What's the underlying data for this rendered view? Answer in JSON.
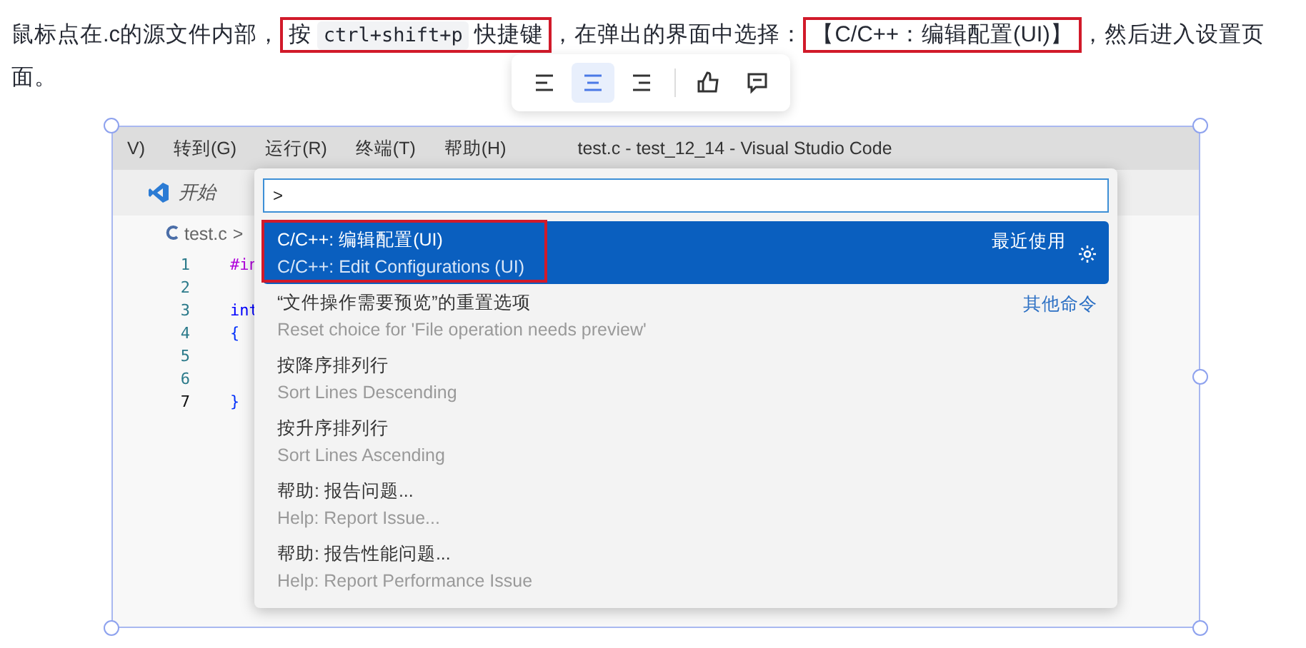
{
  "intro": {
    "segments": [
      {
        "kind": "text",
        "text": "鼠标点在.c的源文件内部，"
      },
      {
        "kind": "highlight",
        "parts": [
          {
            "kind": "text",
            "text": "按 "
          },
          {
            "kind": "code",
            "text": "ctrl+shift+p"
          },
          {
            "kind": "text",
            "text": " 快捷键"
          }
        ]
      },
      {
        "kind": "text",
        "text": "，在弹出的界面中选择："
      },
      {
        "kind": "highlight",
        "parts": [
          {
            "kind": "text",
            "text": "【C/C++：编辑配置(UI)】"
          }
        ]
      },
      {
        "kind": "text",
        "text": "，然后进入设置页面。"
      }
    ]
  },
  "image_toolbar": {
    "buttons": [
      {
        "kind": "align-left",
        "selected": false
      },
      {
        "kind": "align-center",
        "selected": true
      },
      {
        "kind": "align-right",
        "selected": false
      },
      {
        "kind": "thumbs-up",
        "selected": false
      },
      {
        "kind": "comment",
        "selected": false
      }
    ]
  },
  "screenshot": {
    "menu": [
      "V)",
      "转到(G)",
      "运行(R)",
      "终端(T)",
      "帮助(H)"
    ],
    "title": "test.c - test_12_14 - Visual Studio Code",
    "tab": "开始",
    "breadcrumb": {
      "file": "test.c",
      "separator": ">"
    },
    "lines": [
      {
        "number": "1",
        "code": "#in",
        "kind": "directive",
        "current": false
      },
      {
        "number": "2",
        "kind": "empty",
        "current": false
      },
      {
        "number": "3",
        "code": "int",
        "kind": "keyword",
        "current": false
      },
      {
        "number": "4",
        "code": "{",
        "kind": "brace",
        "current": false
      },
      {
        "number": "5",
        "kind": "empty",
        "current": false
      },
      {
        "number": "6",
        "kind": "empty",
        "current": false
      },
      {
        "number": "7",
        "code": "}",
        "kind": "brace",
        "current": true
      }
    ],
    "palette": {
      "value": ">",
      "items": [
        {
          "title": "C/C++: 编辑配置(UI)",
          "subtitle": "C/C++: Edit Configurations (UI)",
          "tag": "最近使用",
          "selected": true,
          "annotated": true
        },
        {
          "title": "“文件操作需要预览”的重置选项",
          "subtitle": "Reset choice for 'File operation needs preview'",
          "tag": "其他命令",
          "selected": false,
          "annotated": false
        },
        {
          "title": "按降序排列行",
          "subtitle": "Sort Lines Descending",
          "selected": false,
          "annotated": false
        },
        {
          "title": "按升序排列行",
          "subtitle": "Sort Lines Ascending",
          "selected": false,
          "annotated": false
        },
        {
          "title": "帮助: 报告问题...",
          "subtitle": "Help: Report Issue...",
          "selected": false,
          "annotated": false
        },
        {
          "title": "帮助: 报告性能问题...",
          "subtitle": "Help: Report Performance Issue",
          "selected": false,
          "annotated": false
        }
      ]
    }
  }
}
